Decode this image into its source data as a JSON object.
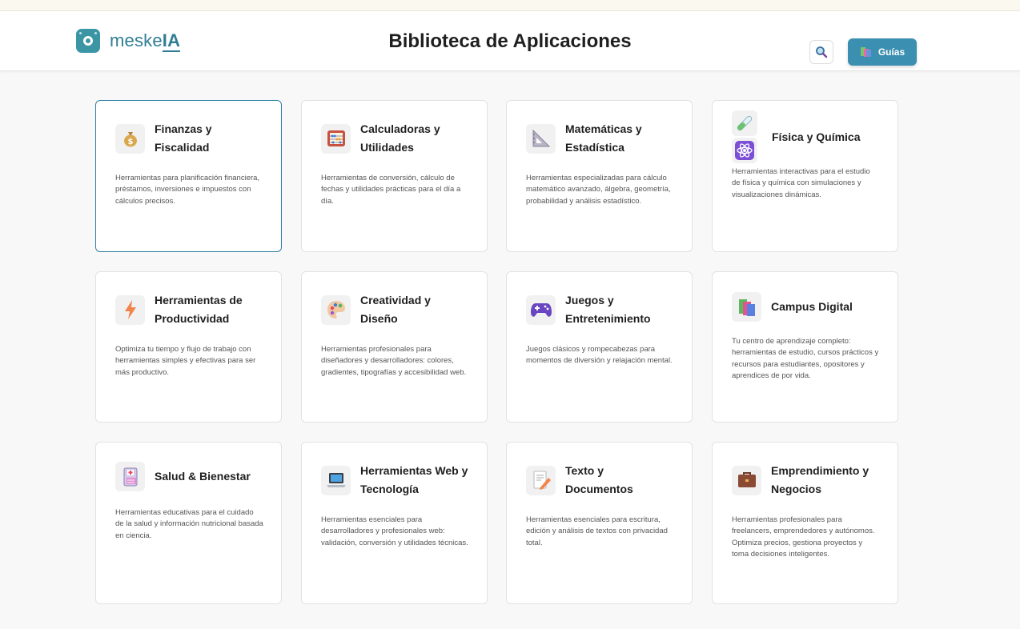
{
  "header": {
    "brand_prefix": "meske",
    "brand_suffix": "IA",
    "title": "Biblioteca de Aplicaciones",
    "guides_label": "Guías"
  },
  "colors": {
    "accent": "#3b8fb0",
    "brand": "#2f7d94",
    "active_border": "#2f7fa4"
  },
  "cards": [
    {
      "title": "Finanzas y Fiscalidad",
      "icon": "money-bag-icon",
      "description": "Herramientas para planificación financiera, préstamos, inversiones e impuestos con cálculos precisos."
    },
    {
      "title": "Calculadoras y Utilidades",
      "icon": "abacus-icon",
      "description": "Herramientas de conversión, cálculo de fechas y utilidades prácticas para el día a día."
    },
    {
      "title": "Matemáticas y Estadística",
      "icon": "triangle-ruler-icon",
      "description": "Herramientas especializadas para cálculo matemático avanzado, álgebra, geometría, probabilidad y análisis estadístico."
    },
    {
      "title": "Física y Química",
      "icon": "test-tube-atom-icon",
      "description": "Herramientas interactivas para el estudio de física y química con simulaciones y visualizaciones dinámicas."
    },
    {
      "title": "Herramientas de Productividad",
      "icon": "lightning-icon",
      "description": "Optimiza tu tiempo y flujo de trabajo con herramientas simples y efectivas para ser más productivo."
    },
    {
      "title": "Creatividad y Diseño",
      "icon": "palette-icon",
      "description": "Herramientas profesionales para diseñadores y desarrolladores: colores, gradientes, tipografías y accesibilidad web."
    },
    {
      "title": "Juegos y Entretenimiento",
      "icon": "gamepad-icon",
      "description": "Juegos clásicos y rompecabezas para momentos de diversión y relajación mental."
    },
    {
      "title": "Campus Digital",
      "icon": "books-icon",
      "description": "Tu centro de aprendizaje completo: herramientas de estudio, cursos prácticos y recursos para estudiantes, opositores y aprendices de por vida."
    },
    {
      "title": "Salud & Bienestar",
      "icon": "medical-card-icon",
      "description": "Herramientas educativas para el cuidado de la salud y información nutricional basada en ciencia."
    },
    {
      "title": "Herramientas Web y Tecnología",
      "icon": "laptop-icon",
      "description": "Herramientas esenciales para desarrolladores y profesionales web: validación, conversión y utilidades técnicas."
    },
    {
      "title": "Texto y Documentos",
      "icon": "document-pencil-icon",
      "description": "Herramientas esenciales para escritura, edición y análisis de textos con privacidad total."
    },
    {
      "title": "Emprendimiento y Negocios",
      "icon": "briefcase-icon",
      "description": "Herramientas profesionales para freelancers, emprendedores y autónomos. Optimiza precios, gestiona proyectos y toma decisiones inteligentes."
    }
  ]
}
